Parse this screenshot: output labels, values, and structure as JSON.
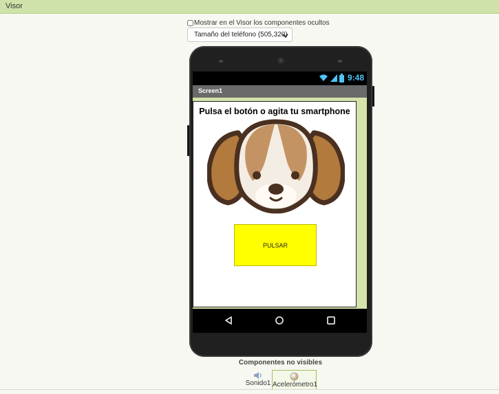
{
  "panel": {
    "title": "Visor",
    "show_hidden_label": "Mostrar en el Visor los componentes ocultos",
    "size_select_value": "Tamaño del teléfono (505,320)"
  },
  "phone": {
    "status_time": "9:48",
    "screen_title": "Screen1",
    "label_text": "Pulsa el botón o agita tu smartphone",
    "button_text": "PULSAR"
  },
  "nonvisible": {
    "title": "Componentes no visibles",
    "items": [
      {
        "label": "Sonido1",
        "icon": "speaker-icon"
      },
      {
        "label": "Acelerómetro1",
        "icon": "accelerometer-icon"
      }
    ]
  },
  "colors": {
    "header_green": "#cfe2a9",
    "button_yellow": "#ffff00",
    "status_blue": "#4fc3f7",
    "title_bar_gray": "#6a6a6a"
  }
}
